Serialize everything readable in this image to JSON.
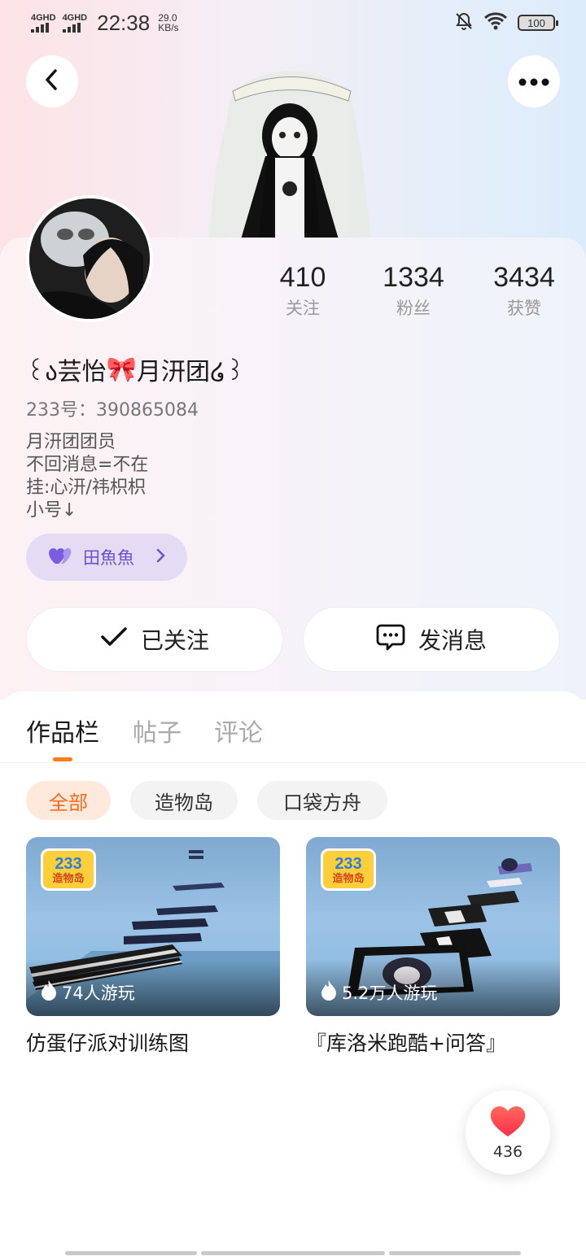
{
  "status_bar": {
    "signal1": "4GHD",
    "signal2": "4GHD",
    "time": "22:38",
    "speed_value": "29.0",
    "speed_unit": "KB/s",
    "battery": "100"
  },
  "profile": {
    "stats": [
      {
        "value": "410",
        "label": "关注"
      },
      {
        "value": "1334",
        "label": "粉丝"
      },
      {
        "value": "3434",
        "label": "获赞"
      }
    ],
    "nickname_parts": {
      "left": "꒰ა芸怡",
      "bow": "🎀",
      "right": "月汧团໒꒱"
    },
    "uid": "233号：390865084",
    "bio": [
      "月汧团团员",
      "不回消息=不在",
      "挂:心汧/祎枳枳",
      "小号↓"
    ],
    "family_tag": "田魚魚",
    "follow_button": "已关注",
    "message_button": "发消息"
  },
  "tabs": [
    "作品栏",
    "帖子",
    "评论"
  ],
  "filters": [
    "全部",
    "造物岛",
    "口袋方舟"
  ],
  "games": [
    {
      "plays": "74人游玩",
      "title": "仿蛋仔派对训练图",
      "logo_top": "233",
      "logo_bottom": "造物岛"
    },
    {
      "plays": "5.2万人游玩",
      "title": "『库洛米跑酷+问答』",
      "logo_top": "233",
      "logo_bottom": "造物岛"
    }
  ],
  "like_count": "436",
  "colors": {
    "accent": "#ff7a1a",
    "family_tag": "#6a54c9",
    "like": "#ff4b4b"
  }
}
